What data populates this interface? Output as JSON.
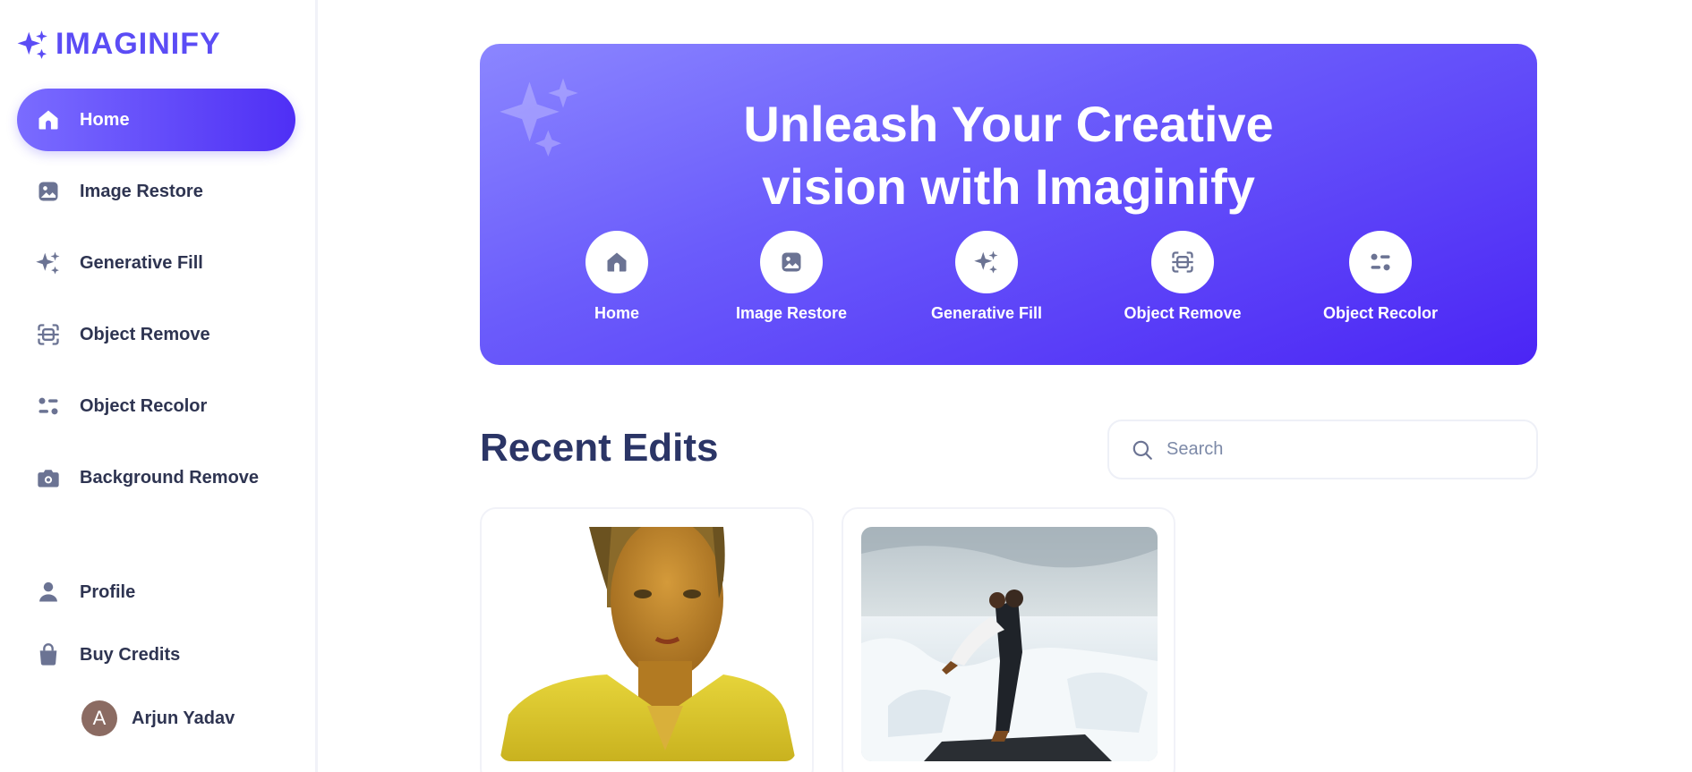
{
  "app": {
    "logo_text": "IMAGINIFY"
  },
  "sidebar": {
    "items": [
      {
        "label": "Home",
        "icon": "home-icon",
        "active": true
      },
      {
        "label": "Image Restore",
        "icon": "image-icon"
      },
      {
        "label": "Generative Fill",
        "icon": "sparkles-icon"
      },
      {
        "label": "Object Remove",
        "icon": "scan-icon"
      },
      {
        "label": "Object Recolor",
        "icon": "filter-icon"
      },
      {
        "label": "Background Remove",
        "icon": "camera-icon"
      }
    ],
    "bottom_items": [
      {
        "label": "Profile",
        "icon": "profile-icon"
      },
      {
        "label": "Buy Credits",
        "icon": "bag-icon"
      }
    ],
    "user": {
      "initial": "A",
      "name": "Arjun Yadav"
    }
  },
  "banner": {
    "title_line1": "Unleash Your Creative",
    "title_line2": "vision with Imaginify",
    "links": [
      {
        "label": "Home",
        "icon": "home-icon"
      },
      {
        "label": "Image Restore",
        "icon": "image-icon"
      },
      {
        "label": "Generative Fill",
        "icon": "sparkles-icon"
      },
      {
        "label": "Object Remove",
        "icon": "scan-icon"
      },
      {
        "label": "Object Recolor",
        "icon": "filter-icon"
      }
    ]
  },
  "recent": {
    "title": "Recent Edits",
    "search_placeholder": "Search",
    "cards": [
      {
        "image": "woman-portrait-yellow-tint"
      },
      {
        "image": "couple-on-ice-beach"
      }
    ]
  },
  "colors": {
    "accent": "#5b4cf5",
    "banner_start": "#8b86ff",
    "banner_end": "#4b25f5",
    "heading": "#2b3566",
    "icon_gray": "#6b7393"
  }
}
